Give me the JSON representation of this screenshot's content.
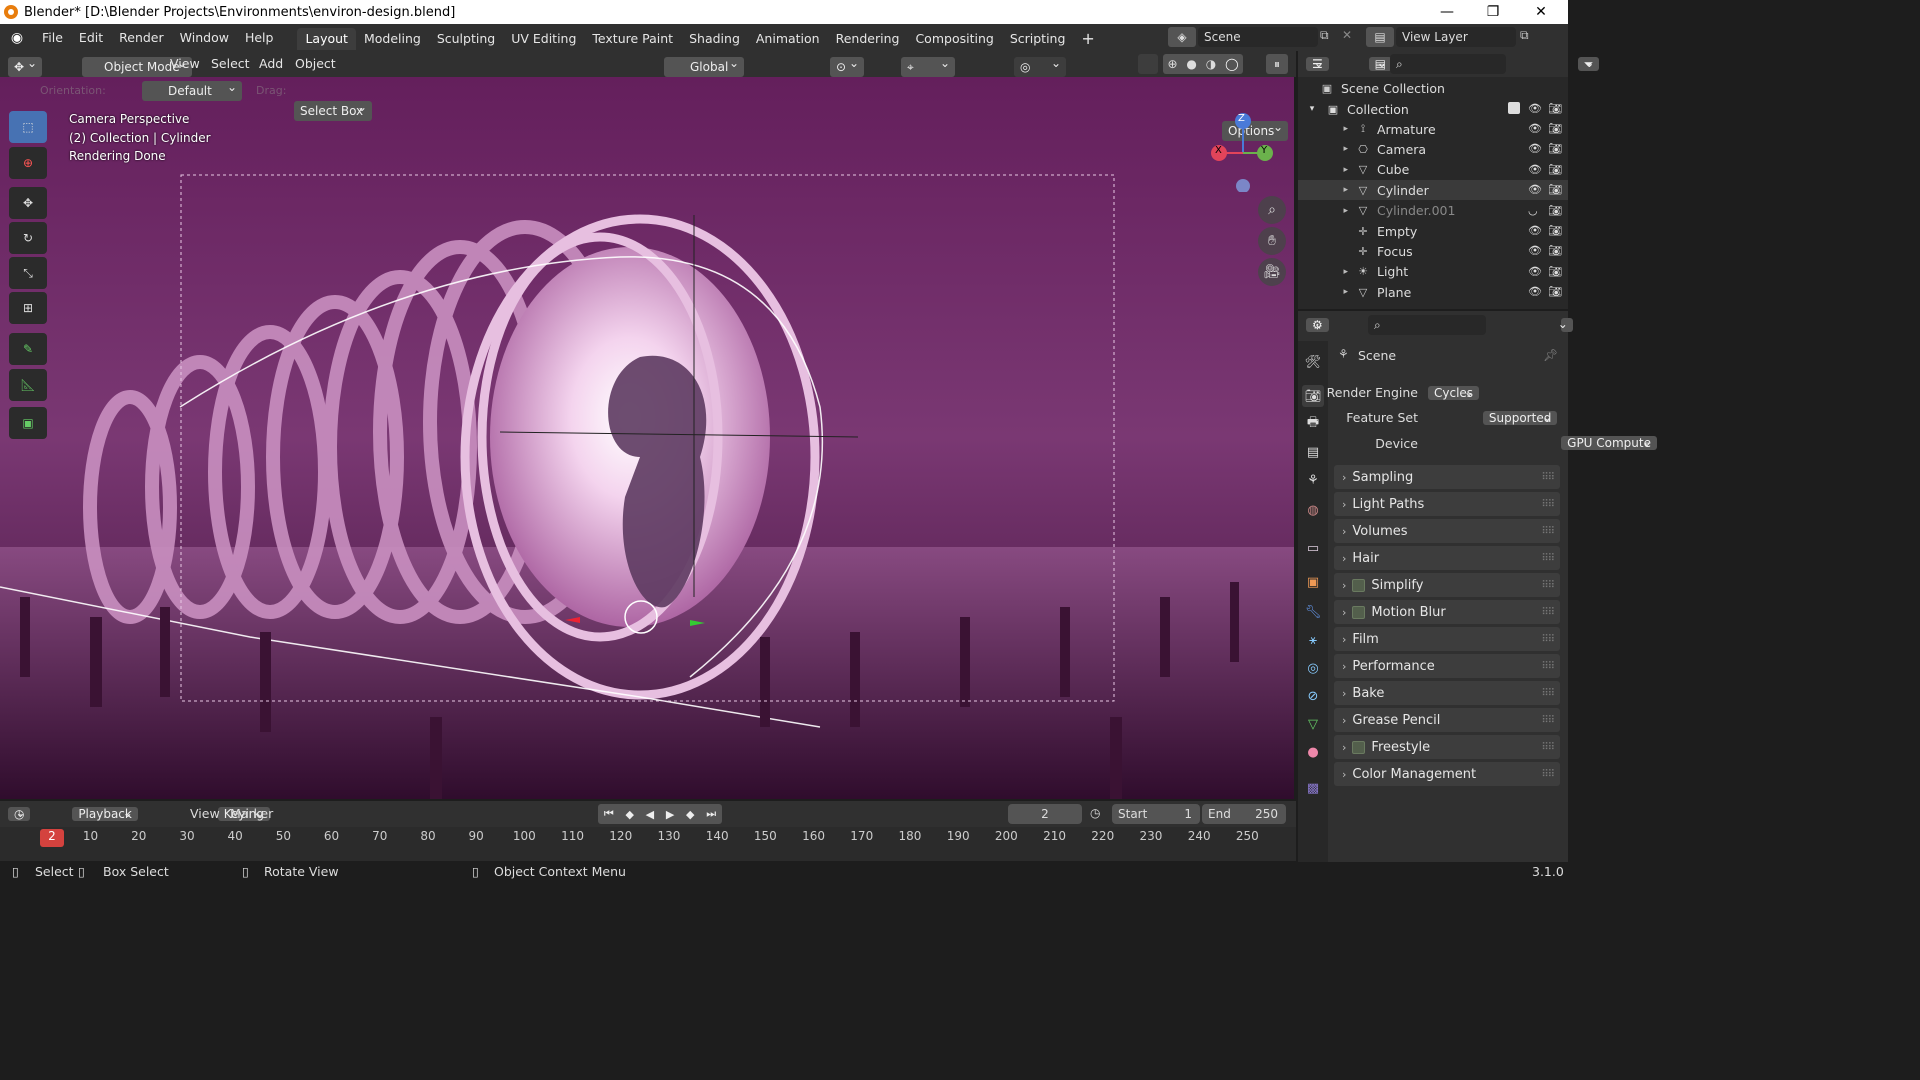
{
  "window": {
    "title": "Blender* [D:\\Blender Projects\\Environments\\environ-design.blend]"
  },
  "menu": {
    "items": [
      "File",
      "Edit",
      "Render",
      "Window",
      "Help"
    ]
  },
  "workspaces": [
    "Layout",
    "Modeling",
    "Sculpting",
    "UV Editing",
    "Texture Paint",
    "Shading",
    "Animation",
    "Rendering",
    "Compositing",
    "Scripting"
  ],
  "active_workspace": "Layout",
  "scene_field": "Scene",
  "view_layer_field": "View Layer",
  "header3d": {
    "mode": "Object Mode",
    "menus": [
      "View",
      "Select",
      "Add",
      "Object"
    ],
    "orientation": "Global"
  },
  "toolsettings": {
    "orientation_label": "Orientation:",
    "orientation_value": "Default",
    "drag_label": "Drag:",
    "drag_value": "Select Box",
    "options": "Options"
  },
  "viewport": {
    "line1": "Camera Perspective",
    "line2": "(2) Collection | Cylinder",
    "line3": "Rendering Done"
  },
  "gizmo": {
    "z": "Z",
    "y": "Y",
    "x": "X"
  },
  "outliner": {
    "root": "Scene Collection",
    "collection": "Collection",
    "items": [
      {
        "name": "Armature",
        "icon": "armature-icon"
      },
      {
        "name": "Camera",
        "icon": "camera-icon"
      },
      {
        "name": "Cube",
        "icon": "mesh-icon"
      },
      {
        "name": "Cylinder",
        "icon": "mesh-icon"
      },
      {
        "name": "Cylinder.001",
        "icon": "mesh-icon"
      },
      {
        "name": "Empty",
        "icon": "empty-icon"
      },
      {
        "name": "Focus",
        "icon": "empty-icon"
      },
      {
        "name": "Light",
        "icon": "light-icon"
      },
      {
        "name": "Plane",
        "icon": "mesh-icon"
      }
    ],
    "selected": "Cylinder"
  },
  "properties": {
    "context": "Scene",
    "render_engine_label": "Render Engine",
    "render_engine": "Cycles",
    "feature_set_label": "Feature Set",
    "feature_set": "Supported",
    "device_label": "Device",
    "device": "GPU Compute",
    "panels": [
      "Sampling",
      "Light Paths",
      "Volumes",
      "Hair",
      "Simplify",
      "Motion Blur",
      "Film",
      "Performance",
      "Bake",
      "Grease Pencil",
      "Freestyle",
      "Color Management"
    ],
    "checkbox_panels": [
      "Simplify",
      "Motion Blur",
      "Freestyle"
    ]
  },
  "timeline": {
    "playback": "Playback",
    "keying": "Keying",
    "view": "View",
    "marker": "Marker",
    "current_frame": "2",
    "start_label": "Start",
    "start": "1",
    "end_label": "End",
    "end": "250",
    "ticks": [
      "2",
      "10",
      "20",
      "30",
      "40",
      "50",
      "60",
      "70",
      "80",
      "90",
      "100",
      "110",
      "120",
      "130",
      "140",
      "150",
      "160",
      "170",
      "180",
      "190",
      "200",
      "210",
      "220",
      "230",
      "240",
      "250"
    ]
  },
  "status": {
    "select": "Select",
    "box_select": "Box Select",
    "rotate": "Rotate View",
    "context_menu": "Object Context Menu",
    "version": "3.1.0"
  },
  "colors": {
    "accent": "#4772b3",
    "header": "#303030",
    "viewport_bg": "#5a1d52"
  }
}
